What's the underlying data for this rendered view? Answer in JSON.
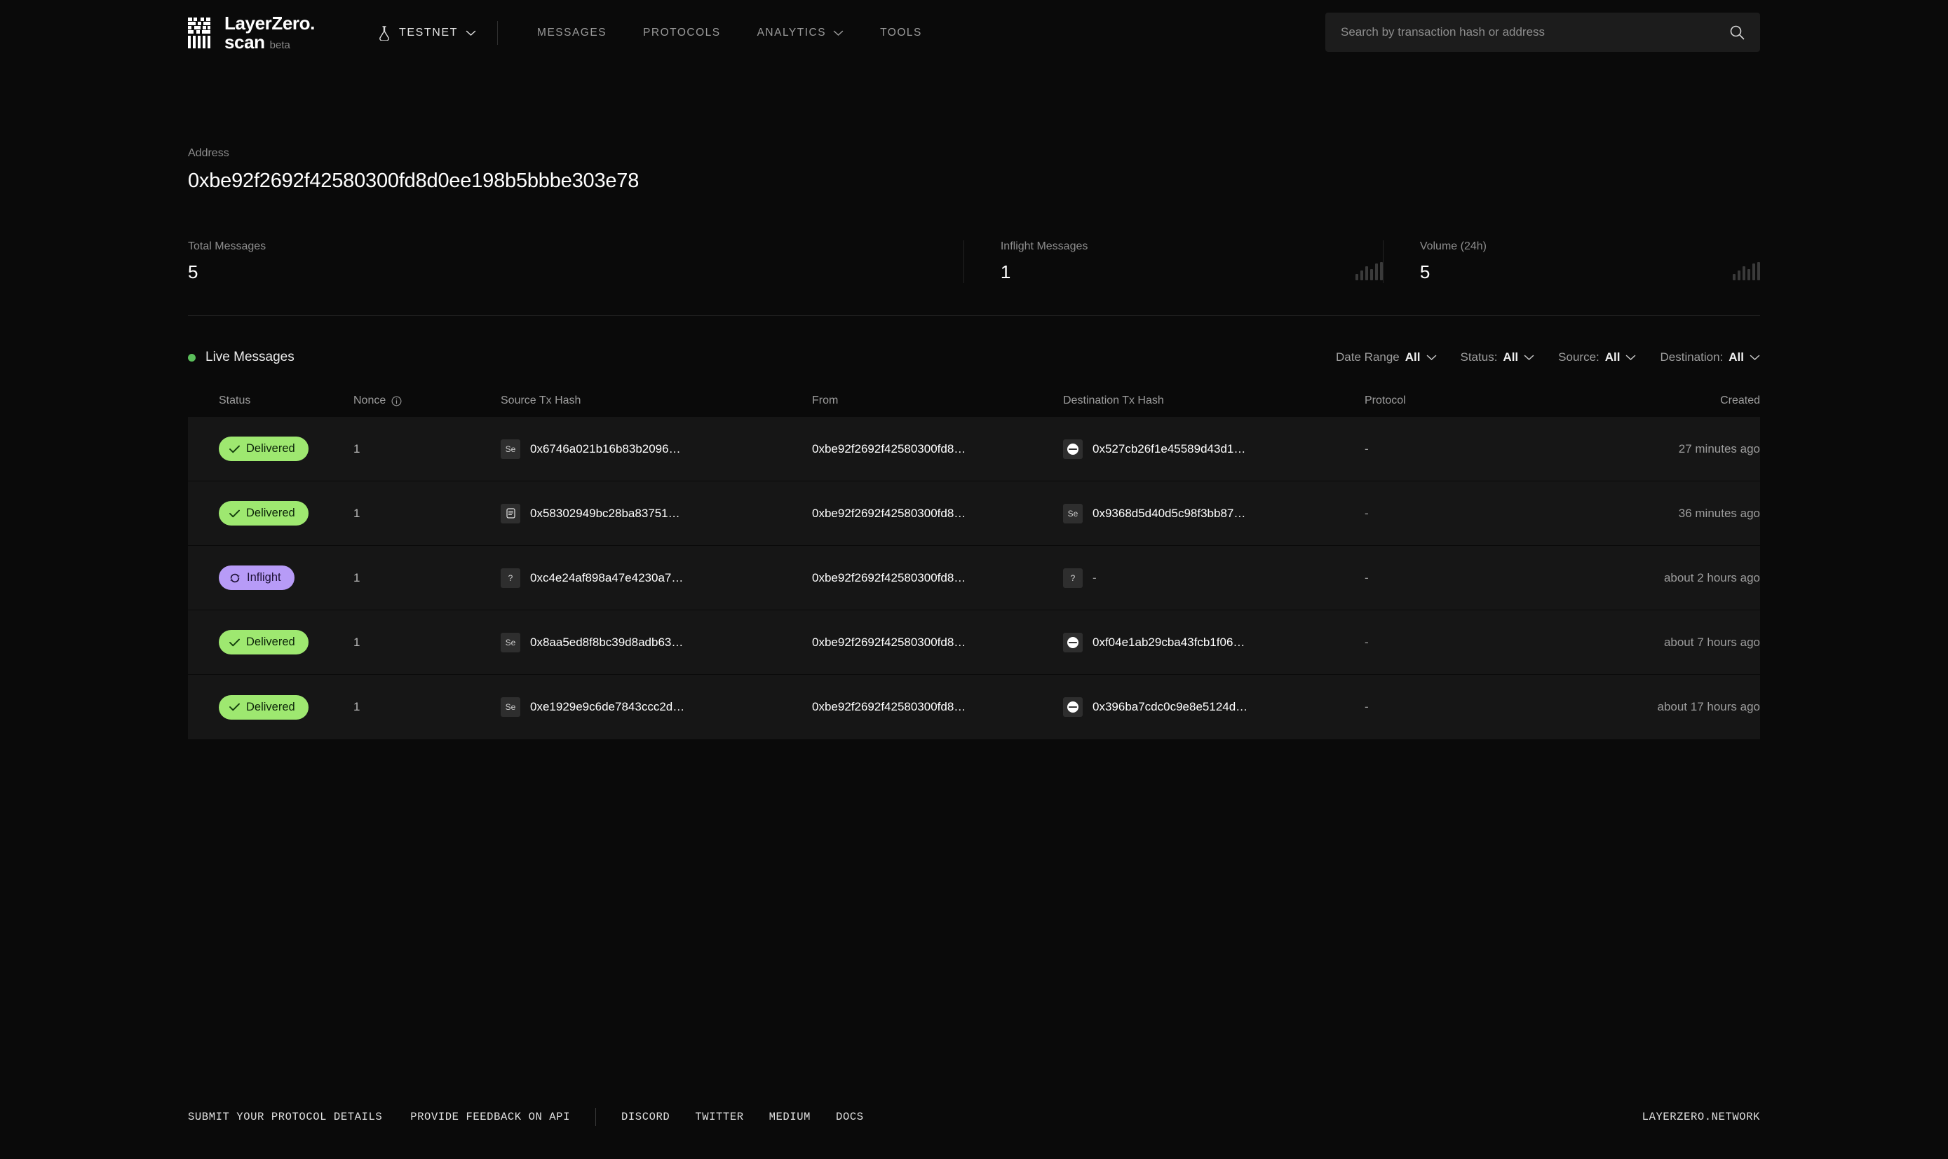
{
  "header": {
    "logo": {
      "line1": "LayerZero.",
      "line2": "scan",
      "beta": "beta",
      "mark_icon": "layerzero-logo-icon"
    },
    "network": {
      "label": "TESTNET",
      "icon": "flask-icon",
      "chevron": "chevron-down-icon"
    },
    "nav": [
      {
        "label": "MESSAGES",
        "has_chevron": false
      },
      {
        "label": "PROTOCOLS",
        "has_chevron": false
      },
      {
        "label": "ANALYTICS",
        "has_chevron": true
      },
      {
        "label": "TOOLS",
        "has_chevron": false
      }
    ],
    "search": {
      "placeholder": "Search by transaction hash or address",
      "value": "",
      "icon": "search-icon"
    }
  },
  "address_panel": {
    "label": "Address",
    "value": "0xbe92f2692f42580300fd8d0ee198b5bbbe303e78"
  },
  "stats": [
    {
      "label": "Total Messages",
      "value": "5",
      "sparkline": false
    },
    {
      "label": "Inflight Messages",
      "value": "1",
      "sparkline": true
    },
    {
      "label": "Volume (24h)",
      "value": "5",
      "sparkline": true
    }
  ],
  "live_section": {
    "title": "Live Messages",
    "status_dot_color": "#5bbf5b",
    "filters": [
      {
        "key": "Date Range",
        "value": "All"
      },
      {
        "key": "Status:",
        "value": "All"
      },
      {
        "key": "Source:",
        "value": "All"
      },
      {
        "key": "Destination:",
        "value": "All"
      }
    ]
  },
  "table": {
    "columns": [
      {
        "label": "Status",
        "info_icon": false
      },
      {
        "label": "Nonce",
        "info_icon": true
      },
      {
        "label": "Source Tx Hash",
        "info_icon": false
      },
      {
        "label": "From",
        "info_icon": false
      },
      {
        "label": "Destination Tx Hash",
        "info_icon": false
      },
      {
        "label": "Protocol",
        "info_icon": false
      },
      {
        "label": "Created",
        "info_icon": false
      }
    ],
    "rows": [
      {
        "status": "Delivered",
        "status_type": "delivered",
        "nonce": "1",
        "source_chain_icon": "sepolia-chain-icon",
        "source_chain_label": "Se",
        "source_hash": "0x6746a021b16b83b2096…",
        "from": "0xbe92f2692f42580300fd8…",
        "dest_chain_icon": "optimism-chain-icon",
        "dest_chain_label": "",
        "dest_hash": "0x527cb26f1e45589d43d1…",
        "protocol": "-",
        "created": "27 minutes ago"
      },
      {
        "status": "Delivered",
        "status_type": "delivered",
        "nonce": "1",
        "source_chain_icon": "scroll-chain-icon",
        "source_chain_label": "",
        "source_hash": "0x58302949bc28ba83751…",
        "from": "0xbe92f2692f42580300fd8…",
        "dest_chain_icon": "sepolia-chain-icon",
        "dest_chain_label": "Se",
        "dest_hash": "0x9368d5d40d5c98f3bb87…",
        "protocol": "-",
        "created": "36 minutes ago"
      },
      {
        "status": "Inflight",
        "status_type": "inflight",
        "nonce": "1",
        "source_chain_icon": "unknown-chain-icon",
        "source_chain_label": "?",
        "source_hash": "0xc4e24af898a47e4230a7…",
        "from": "0xbe92f2692f42580300fd8…",
        "dest_chain_icon": "unknown-chain-icon",
        "dest_chain_label": "?",
        "dest_hash": "-",
        "protocol": "-",
        "created": "about 2 hours ago"
      },
      {
        "status": "Delivered",
        "status_type": "delivered",
        "nonce": "1",
        "source_chain_icon": "sepolia-chain-icon",
        "source_chain_label": "Se",
        "source_hash": "0x8aa5ed8f8bc39d8adb63…",
        "from": "0xbe92f2692f42580300fd8…",
        "dest_chain_icon": "optimism-chain-icon",
        "dest_chain_label": "",
        "dest_hash": "0xf04e1ab29cba43fcb1f06…",
        "protocol": "-",
        "created": "about 7 hours ago"
      },
      {
        "status": "Delivered",
        "status_type": "delivered",
        "nonce": "1",
        "source_chain_icon": "sepolia-chain-icon",
        "source_chain_label": "Se",
        "source_hash": "0xe1929e9c6de7843ccc2d…",
        "from": "0xbe92f2692f42580300fd8…",
        "dest_chain_icon": "optimism-chain-icon",
        "dest_chain_label": "",
        "dest_hash": "0x396ba7cdc0c9e8e5124d…",
        "protocol": "-",
        "created": "about 17 hours ago"
      }
    ]
  },
  "footer": {
    "primary_links": [
      "SUBMIT YOUR PROTOCOL DETAILS",
      "PROVIDE FEEDBACK ON API"
    ],
    "social_links": [
      "DISCORD",
      "TWITTER",
      "MEDIUM",
      "DOCS"
    ],
    "right_link": "LAYERZERO.NETWORK"
  },
  "colors": {
    "background": "#0a0a0a",
    "row_background": "#161616",
    "delivered_badge": "#9ee870",
    "inflight_badge": "#b79bf7",
    "live_dot": "#5bbf5b",
    "muted_text": "#9d9d9d"
  }
}
